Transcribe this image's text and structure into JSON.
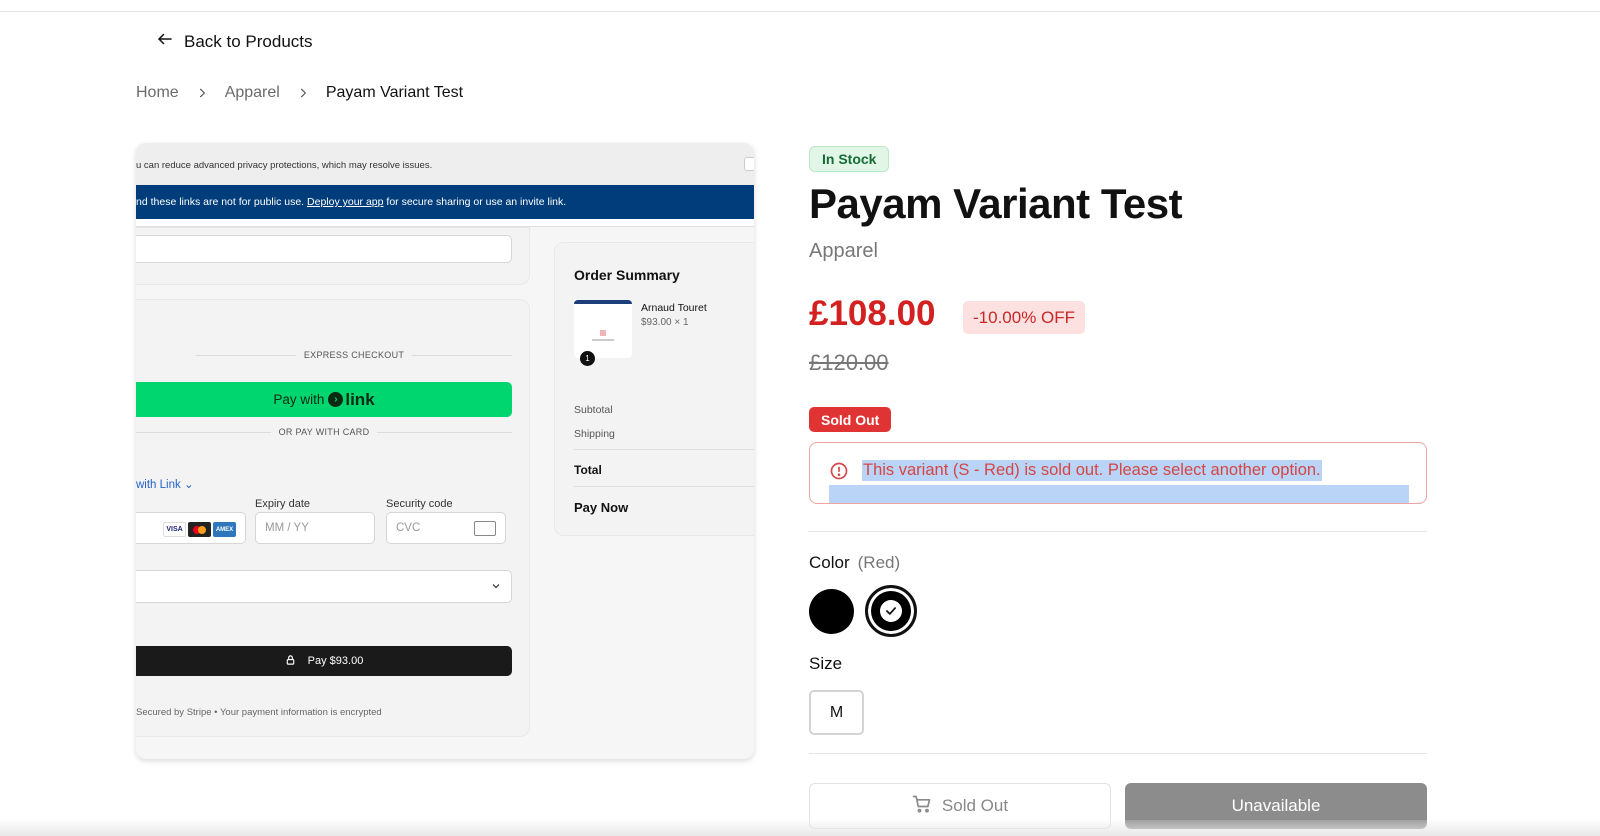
{
  "nav": {
    "back_label": "Back to Products"
  },
  "breadcrumb": {
    "items": [
      "Home",
      "Apparel",
      "Payam Variant Test"
    ]
  },
  "product_image": {
    "warning_text": "u can reduce advanced privacy protections, which may resolve issues.",
    "blue_bar_prefix": "nd these links are not for public use. ",
    "blue_bar_link": "Deploy your app",
    "blue_bar_suffix": " for secure sharing or use an invite link.",
    "express_checkout": "EXPRESS CHECKOUT",
    "pay_with": "Pay with",
    "link_brand": "link",
    "or_pay_card": "OR PAY WITH CARD",
    "with_link": "with Link",
    "expiry_label": "Expiry date",
    "expiry_placeholder": "MM / YY",
    "security_label": "Security code",
    "security_placeholder": "CVC",
    "card_brands": [
      "VISA",
      "MC",
      "AMEX"
    ],
    "pay_button": "Pay $93.00",
    "secured_text": "Secured by Stripe • Your payment information is encrypted",
    "summary": {
      "title": "Order Summary",
      "item_name": "Arnaud Touret",
      "item_price": "$93.00 × 1",
      "qty": "1",
      "subtotal": "Subtotal",
      "shipping": "Shipping",
      "total": "Total",
      "pay_now": "Pay Now"
    }
  },
  "product": {
    "stock_badge": "In Stock",
    "title": "Payam Variant Test",
    "category": "Apparel",
    "price": "£108.00",
    "discount": "-10.00% OFF",
    "compare_price": "£120.00",
    "sold_out_badge": "Sold Out",
    "alert_text": "This variant (S - Red) is sold out. Please select another option.",
    "color_label": "Color",
    "color_selected": "(Red)",
    "swatch_colors": [
      "#000000",
      "#000000"
    ],
    "size_label": "Size",
    "sizes": [
      "M"
    ],
    "sold_out_button": "Sold Out",
    "unavailable_button": "Unavailable"
  },
  "colors": {
    "price_red": "#d32020",
    "stock_green": "#156b34",
    "badge_red": "#e03434",
    "link_green": "#00d66f"
  }
}
